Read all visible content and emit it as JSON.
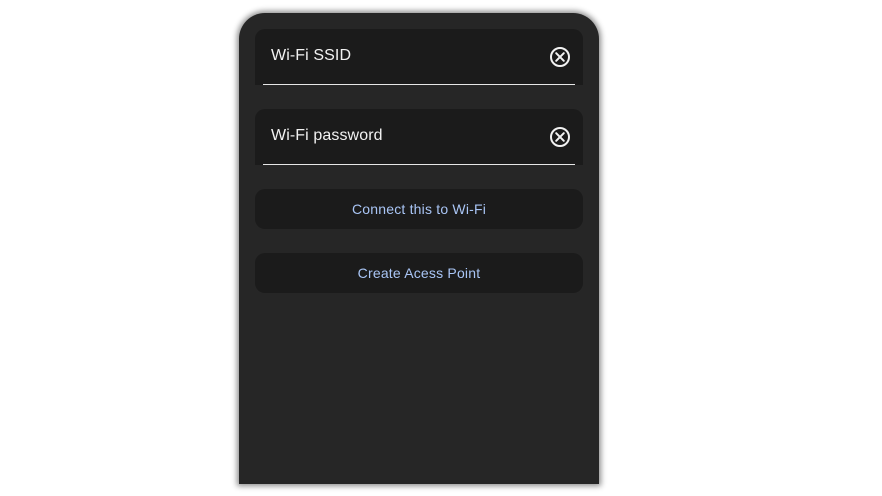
{
  "form": {
    "ssid_field": {
      "label": "Wi-Fi SSID",
      "value": "",
      "clear_icon": "cancel-circle-icon"
    },
    "password_field": {
      "label": "Wi-Fi password",
      "value": "",
      "clear_icon": "cancel-circle-icon"
    },
    "connect_button_label": "Connect this to Wi-Fi",
    "access_point_button_label": "Create Acess Point"
  },
  "colors": {
    "surface": "#262626",
    "field_background": "#1b1b1b",
    "button_text": "#a9c5f5",
    "text": "#f2f2f2"
  }
}
